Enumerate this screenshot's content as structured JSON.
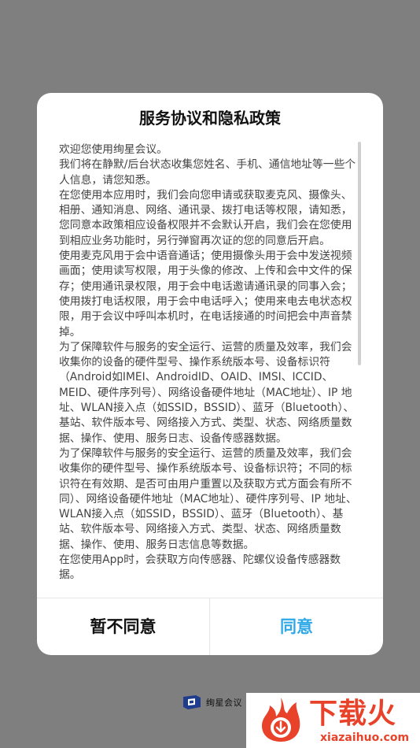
{
  "dialog": {
    "title": "服务协议和隐私政策",
    "paragraphs": [
      "欢迎您使用绚星会议。",
      "我们将在静默/后台状态收集您姓名、手机、通信地址等一些个人信息，请您知悉。",
      "在您使用本应用时，我们会向您申请或获取麦克风、摄像头、相册、通知消息、网络、通讯录、拨打电话等权限，请知悉，您同意本政策相应设备权限并不会默认开启，我们会在您使用到相应业务功能时，另行弹窗再次证的您的同意后开启。",
      "使用麦克风用于会中语音通话；使用摄像头用于会中发送视频画面；使用读写权限，用于头像的修改、上传和会中文件的保存；使用通讯录权限，用于会中电话邀请通讯录的同事入会；使用拨打电话权限，用于会中电话呼入；使用来电去电状态权限，用于会议中呼叫本机时，在电话接通的时间把会中声音禁掉。",
      "为了保障软件与服务的安全运行、运营的质量及效率，我们会收集你的设备的硬件型号、操作系统版本号、设备标识符（Android如IMEI、AndroidID、OAID、IMSI、ICCID、MEID、硬件序列号）、网络设备硬件地址（MAC地址）、IP 地址、WLAN接入点（如SSID，BSSID）、蓝牙（Bluetooth）、基站、软件版本号、网络接入方式、类型、状态、网络质量数据、操作、使用、服务日志、设备传感器数据。",
      "为了保障软件与服务的安全运行、运营的质量及效率，我们会收集你的硬件型号、操作系统版本号、设备标识符；不同的标识符在有效期、是否可由用户重置以及获取方式方面会有所不同）、网络设备硬件地址（MAC地址）、硬件序列号、IP 地址、WLAN接入点（如SSID，BSSID）、蓝牙（Bluetooth）、基站、软件版本号、网络接入方式、类型、状态、网络质量数据、操作、使用、服务日志信息等数据。",
      "在您使用App时，会获取方向传感器、陀螺仪设备传感器数据。"
    ],
    "disagree_label": "暂不同意",
    "agree_label": "同意"
  },
  "brand": {
    "name": "绚星会议"
  },
  "watermark": {
    "title": "下载火",
    "url": "xiazaihuo.com"
  },
  "colors": {
    "overlay": "#7f7f7f",
    "accent": "#2fa8e8",
    "brand_blue": "#1f3d8c",
    "watermark_red": "#e8432a"
  }
}
